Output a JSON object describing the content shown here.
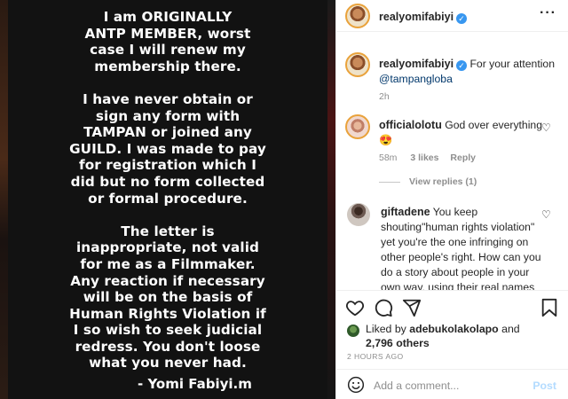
{
  "image": {
    "body_text": "I am ORIGINALLY\nANTP MEMBER, worst\ncase I will renew my\nmembership there.\n\nI have never obtain or\nsign any form with\nTAMPAN or joined any\nGUILD. I was made to pay\nfor registration which I\ndid but no form collected\nor formal procedure.\n\nThe letter is\ninappropriate, not valid\nfor me as a Filmmaker.\nAny reaction if necessary\nwill be on the basis of\nHuman Rights Violation if\nI so wish to seek judicial\nredress. You don't loose\nwhat you never had.",
    "signature": "- Yomi Fabiyi.m"
  },
  "header": {
    "username": "realyomifabiyi",
    "verified": true,
    "more_icon": "more-horizontal-icon"
  },
  "caption": {
    "username": "realyomifabiyi",
    "text": "For your attention",
    "mention": "@tampangloba",
    "time": "2h"
  },
  "comments": [
    {
      "username": "officialolotu",
      "text": "God over everything",
      "emoji": "😍",
      "time": "58m",
      "likes": "3 likes",
      "reply_label": "Reply",
      "view_replies": "View replies (1)"
    },
    {
      "username": "giftadene",
      "text": "You keep shouting\"human rights violation\" yet you're the one infringing on other people's right. How can you do a story about people in your own way, using their real names and changing the narrative"
    }
  ],
  "actions": {
    "like_icon": "heart-icon",
    "comment_icon": "comment-icon",
    "share_icon": "share-icon",
    "save_icon": "bookmark-icon",
    "liked_by_prefix": "Liked by",
    "liked_by_user": "adebukolakolapo",
    "liked_by_and": "and",
    "liked_by_count": "2,796 others",
    "timestamp": "2 HOURS AGO"
  },
  "add_comment": {
    "emoji_icon": "smiley-icon",
    "placeholder": "Add a comment...",
    "post_label": "Post"
  },
  "colors": {
    "verified": "#3897f0",
    "link": "#00376b",
    "muted": "#8e8e8e",
    "post_disabled": "#b3dbff"
  }
}
